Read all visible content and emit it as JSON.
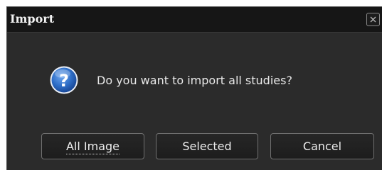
{
  "dialog": {
    "title": "Import",
    "close_icon": "close-icon",
    "icon": "question-icon",
    "message": "Do you want to import all studies?",
    "buttons": {
      "all_image": "All Image",
      "selected": "Selected",
      "cancel": "Cancel"
    }
  },
  "colors": {
    "background": "#2b2b2b",
    "titlebar": "#161616",
    "text": "#e8e8e8",
    "icon_blue": "#2f6fc8",
    "button_border": "#707070"
  }
}
